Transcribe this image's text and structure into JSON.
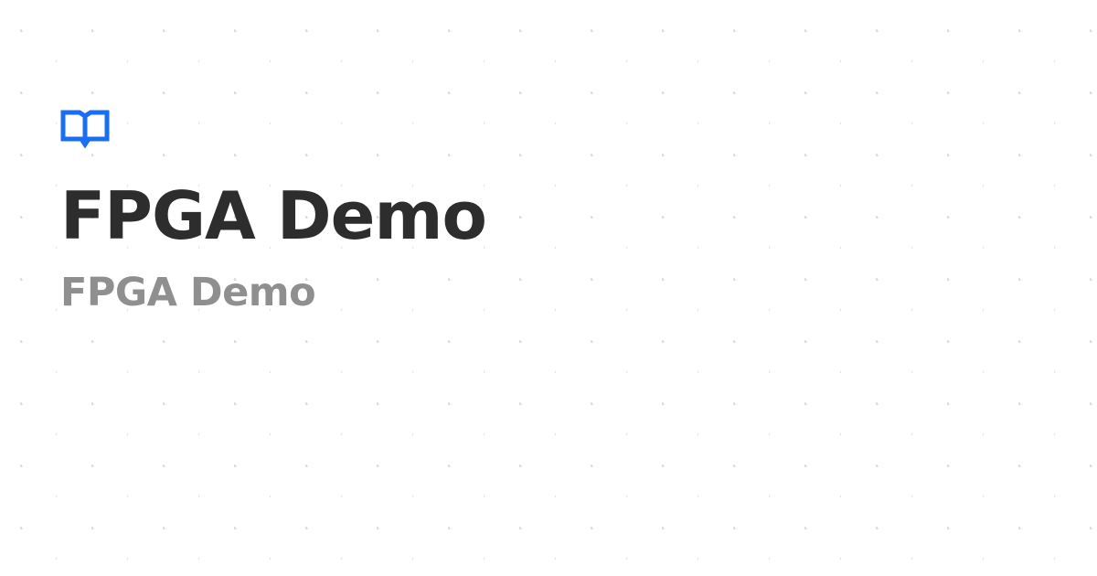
{
  "card": {
    "icon": "book-open-icon",
    "title": "FPGA Demo",
    "subtitle": "FPGA Demo"
  },
  "colors": {
    "background": "#ffffff",
    "accent": "#1a6ef5",
    "title": "#2d2d2d",
    "subtitle": "#8f8f8f",
    "pattern": "#dcdcdc"
  }
}
